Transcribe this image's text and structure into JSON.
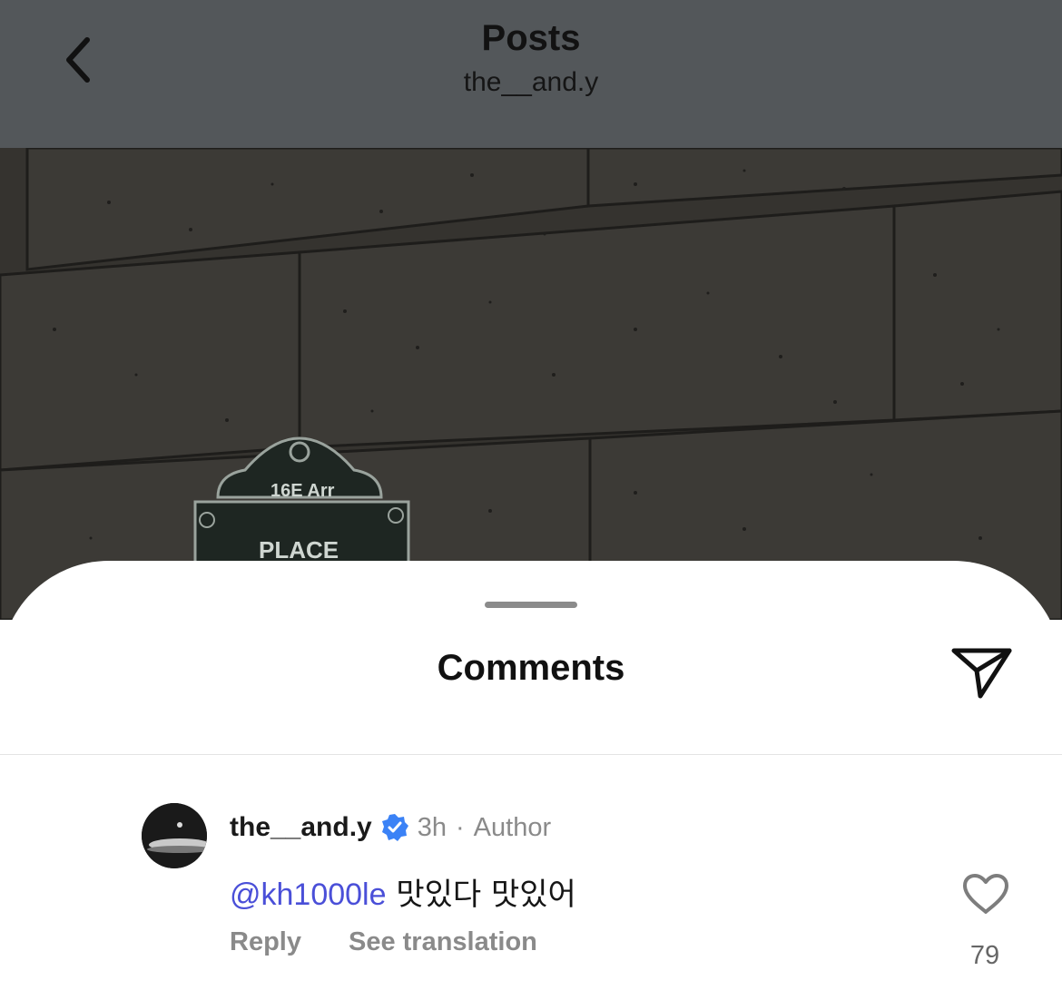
{
  "header": {
    "back_icon": "chevron-left-icon",
    "title": "Posts",
    "subtitle": "the__and.y"
  },
  "post_image": {
    "description_sign_text": "16E Arr",
    "sign_place_text": "PLACE"
  },
  "comments_sheet": {
    "title": "Comments",
    "share_icon": "send-icon",
    "comments": [
      {
        "username": "the__and.y",
        "verified": true,
        "time": "3h",
        "separator": "·",
        "badge": "Author",
        "mention": "@kh1000le",
        "text": "맛있다 맛있어",
        "reply_label": "Reply",
        "translate_label": "See translation",
        "likes": "79"
      }
    ]
  },
  "colors": {
    "header_bg": "#53575a",
    "mention": "#4a4fd8",
    "verified": "#3b82f6",
    "muted": "#8a8a8a"
  }
}
